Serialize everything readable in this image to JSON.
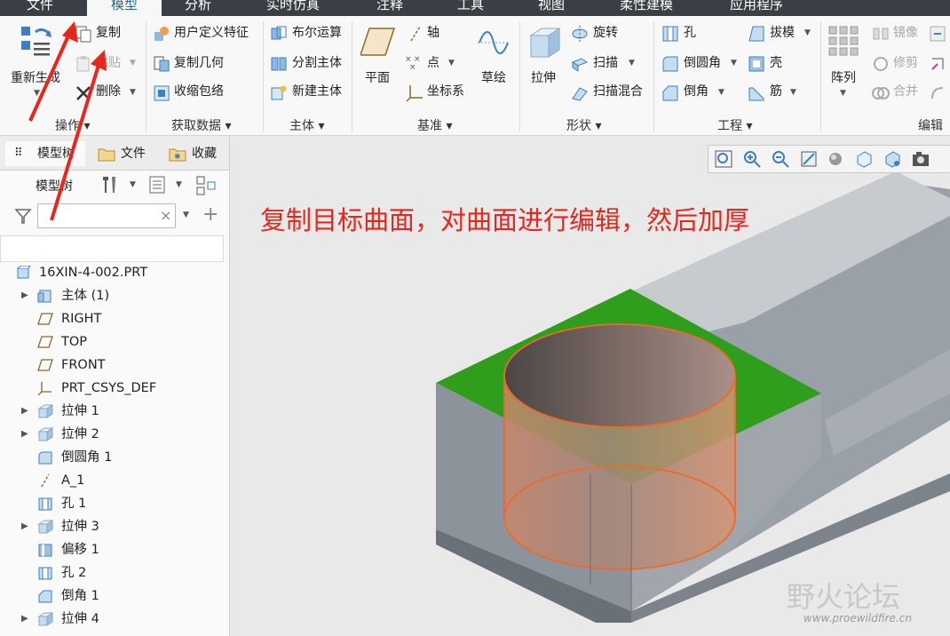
{
  "menu": {
    "tabs": [
      "文件",
      "模型",
      "分析",
      "实时仿真",
      "注释",
      "工具",
      "视图",
      "柔性建模",
      "应用程序"
    ],
    "active": "模型"
  },
  "ribbon": {
    "ops": {
      "regen": "重新生成",
      "copy": "复制",
      "paste": "粘贴",
      "delete": "删除",
      "group": "操作"
    },
    "getdata": {
      "udf": "用户定义特征",
      "copy_geom": "复制几何",
      "shrinkwrap": "收缩包络",
      "group": "获取数据"
    },
    "body": {
      "boolean": "布尔运算",
      "split": "分割主体",
      "new": "新建主体",
      "group": "主体"
    },
    "datum": {
      "plane": "平面",
      "axis": "轴",
      "point": "点",
      "csys": "坐标系",
      "sketch": "草绘",
      "group": "基准"
    },
    "shape": {
      "extrude": "拉伸",
      "revolve": "旋转",
      "sweep": "扫描",
      "swept_blend": "扫描混合",
      "group": "形状"
    },
    "engineering": {
      "hole": "孔",
      "draft": "拔模",
      "round": "倒圆角",
      "shell": "壳",
      "chamfer": "倒角",
      "rib": "筋",
      "group": "工程"
    },
    "editing": {
      "pattern": "阵列",
      "mirror": "镜像",
      "trim": "修剪",
      "merge": "合并",
      "group": "编辑"
    }
  },
  "leftpanel": {
    "tabs": [
      "模型树",
      "文件",
      "收藏"
    ],
    "subheader": "模型树",
    "filter_value": "",
    "tree": [
      {
        "label": "16XIN-4-002.PRT",
        "icon": "part-icon",
        "arrow": ""
      },
      {
        "label": "主体 (1)",
        "icon": "body-icon",
        "arrow": "▶"
      },
      {
        "label": "RIGHT",
        "icon": "datum-plane-icon",
        "arrow": ""
      },
      {
        "label": "TOP",
        "icon": "datum-plane-icon",
        "arrow": ""
      },
      {
        "label": "FRONT",
        "icon": "datum-plane-icon",
        "arrow": ""
      },
      {
        "label": "PRT_CSYS_DEF",
        "icon": "csys-icon",
        "arrow": ""
      },
      {
        "label": "拉伸 1",
        "icon": "extrude-icon",
        "arrow": "▶"
      },
      {
        "label": "拉伸 2",
        "icon": "extrude-icon",
        "arrow": "▶"
      },
      {
        "label": "倒圆角 1",
        "icon": "round-icon",
        "arrow": ""
      },
      {
        "label": "A_1",
        "icon": "axis-icon",
        "arrow": ""
      },
      {
        "label": "孔 1",
        "icon": "hole-icon",
        "arrow": ""
      },
      {
        "label": "拉伸 3",
        "icon": "extrude-icon",
        "arrow": "▶"
      },
      {
        "label": "偏移 1",
        "icon": "offset-icon",
        "arrow": ""
      },
      {
        "label": "孔 2",
        "icon": "hole-icon",
        "arrow": ""
      },
      {
        "label": "倒角 1",
        "icon": "chamfer-icon",
        "arrow": ""
      },
      {
        "label": "拉伸 4",
        "icon": "extrude-icon",
        "arrow": "▶"
      }
    ]
  },
  "viewport": {
    "annotation": "复制目标曲面，对曲面进行编辑，然后加厚",
    "watermark": "野火论坛",
    "watermark_url": "www.proewildfire.cn",
    "colors": {
      "annotation": "#e8261c",
      "surface": "#2e9e1e",
      "highlight": "#f0682a"
    }
  }
}
